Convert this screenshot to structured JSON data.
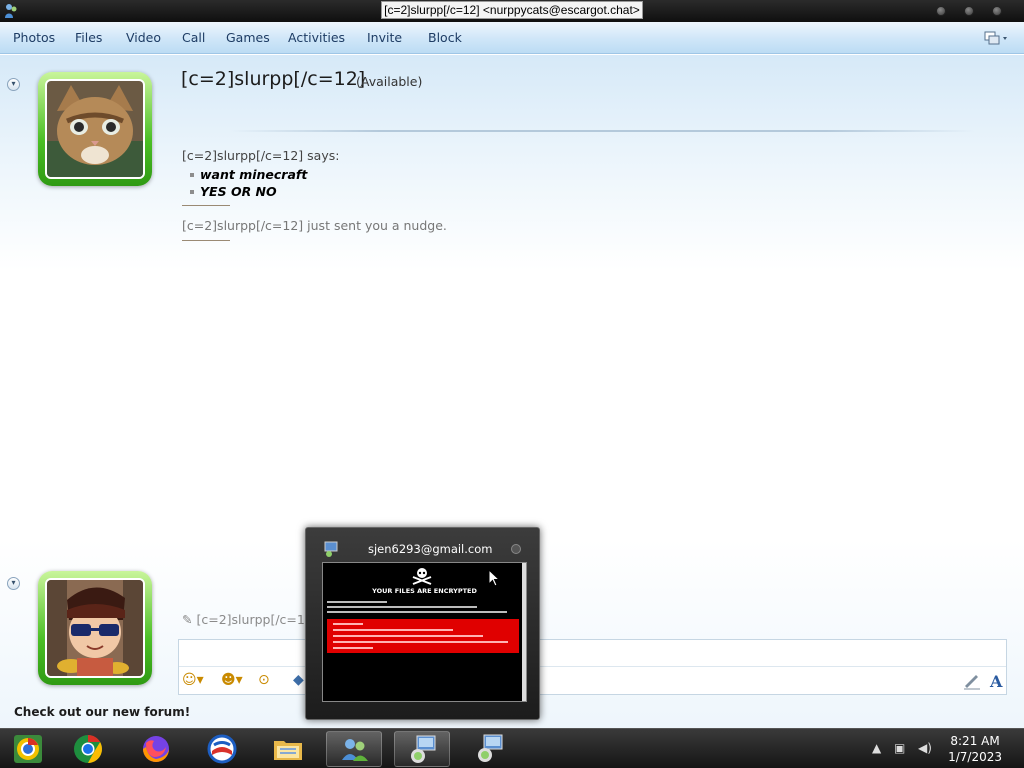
{
  "window": {
    "title": "[c=2]slurpp[/c=12] <nurppycats@escargot.chat>"
  },
  "menu": {
    "items": [
      "Photos",
      "Files",
      "Video",
      "Call",
      "Games",
      "Activities",
      "Invite",
      "Block"
    ]
  },
  "contact": {
    "name": "[c=2]slurpp[/c=12]",
    "status": "(Available)",
    "avatar_icon": "kitten-photo"
  },
  "conversation": {
    "sender_line": "[c=2]slurpp[/c=12] says:",
    "messages": [
      "want minecraft",
      "YES OR NO"
    ],
    "nudge": "[c=2]slurpp[/c=12] just sent you a nudge."
  },
  "self": {
    "avatar_icon": "cartoon-character-sunglasses",
    "typing_name": "[c=2]slurpp[/c=12]",
    "footer_link": "Check out our new forum!"
  },
  "input_toolbar": {
    "font_button": "A"
  },
  "thumbnail_popup": {
    "title": "sjen6293@gmail.com",
    "preview_heading": "YOUR FILES ARE ENCRYPTED"
  },
  "taskbar": {
    "apps": [
      "chrome-dev-icon",
      "chrome-icon",
      "firefox-icon",
      "browser-o-icon",
      "file-explorer-icon",
      "messenger-icon",
      "messenger-window-icon",
      "messenger-window-icon"
    ],
    "time": "8:21 AM",
    "date": "1/7/2023"
  },
  "colors": {
    "menu_text": "#1e3c64",
    "avatar_frame": "#4bbf25",
    "ransom_red": "#e00000"
  }
}
